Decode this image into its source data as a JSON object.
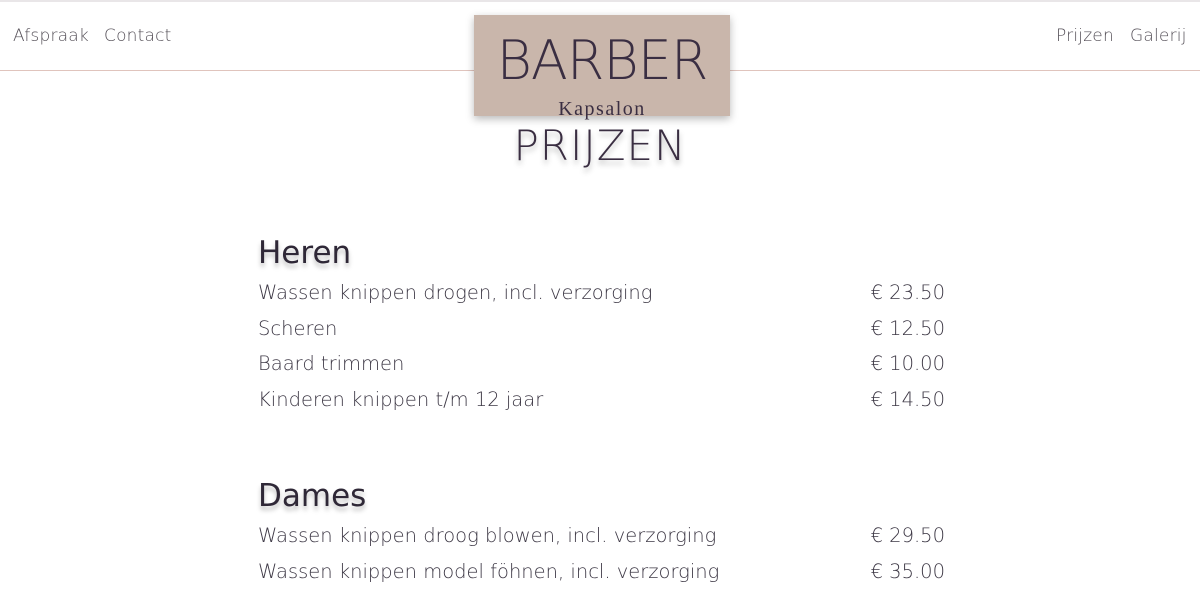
{
  "nav": {
    "left": [
      {
        "label": "Afspraak"
      },
      {
        "label": "Contact"
      }
    ],
    "right": [
      {
        "label": "Prijzen"
      },
      {
        "label": "Galerij"
      }
    ]
  },
  "logo": {
    "title": "BARBER",
    "subtitle": "Kapsalon",
    "background": "#C9B6AB"
  },
  "page_title": "PRIJZEN",
  "sections": [
    {
      "title": "Heren",
      "items": [
        {
          "name": "Wassen knippen drogen, incl. verzorging",
          "price": "€ 23.50"
        },
        {
          "name": "Scheren",
          "price": "€ 12.50"
        },
        {
          "name": "Baard trimmen",
          "price": "€ 10.00"
        },
        {
          "name": "Kinderen knippen t/m 12 jaar",
          "price": "€ 14.50"
        }
      ]
    },
    {
      "title": "Dames",
      "items": [
        {
          "name": "Wassen knippen droog blowen, incl. verzorging",
          "price": "€ 29.50"
        },
        {
          "name": "Wassen knippen model föhnen, incl. verzorging",
          "price": "€ 35.00"
        }
      ]
    }
  ]
}
